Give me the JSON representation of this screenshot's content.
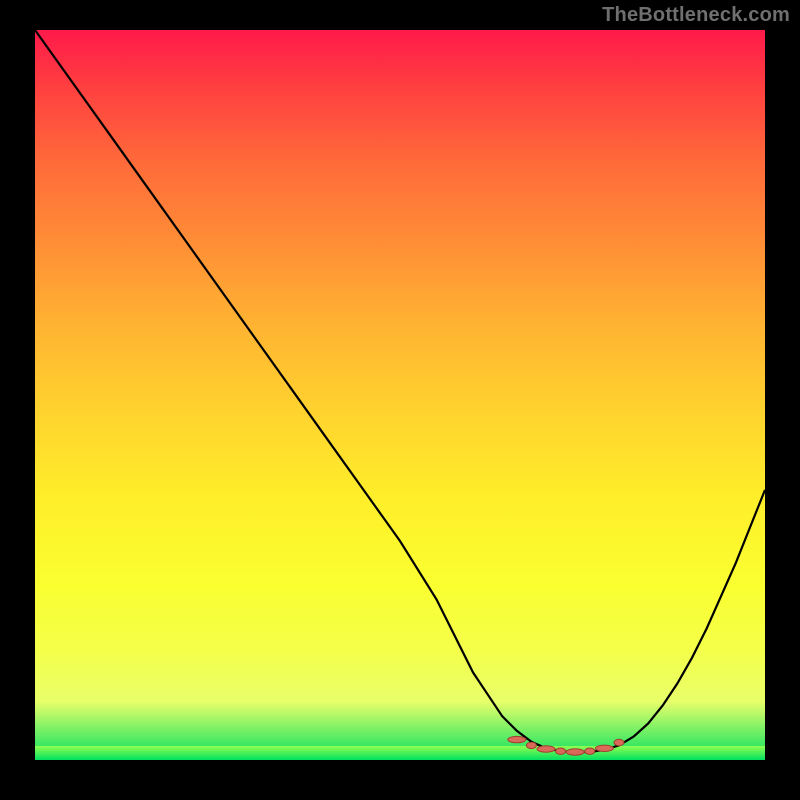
{
  "watermark": "TheBottleneck.com",
  "colors": {
    "background": "#000000",
    "gradient_top": "#ff1a4a",
    "gradient_bottom": "#00e060",
    "curve": "#000000",
    "marker": "#d96a5a"
  },
  "chart_data": {
    "type": "line",
    "title": "",
    "xlabel": "",
    "ylabel": "",
    "xlim": [
      0,
      100
    ],
    "ylim": [
      0,
      100
    ],
    "grid": false,
    "legend": false,
    "x": [
      0,
      5,
      10,
      15,
      20,
      25,
      30,
      35,
      40,
      45,
      50,
      55,
      58,
      60,
      62,
      64,
      66,
      68,
      70,
      72,
      74,
      76,
      78,
      80,
      82,
      84,
      86,
      88,
      90,
      92,
      94,
      96,
      98,
      100
    ],
    "values": [
      100,
      93,
      86,
      79,
      72,
      65,
      58,
      51,
      44,
      37,
      30,
      22,
      16,
      12,
      9,
      6,
      4,
      2.5,
      1.6,
      1.2,
      1.1,
      1.1,
      1.4,
      2,
      3.2,
      5,
      7.5,
      10.5,
      14,
      18,
      22.5,
      27,
      32,
      37
    ],
    "markers": {
      "x": [
        66,
        68,
        70,
        72,
        74,
        76,
        78,
        80
      ],
      "y": [
        2.8,
        2.0,
        1.5,
        1.2,
        1.1,
        1.2,
        1.6,
        2.4
      ]
    },
    "note": "x and y are in percent of the plot area; axes are unlabeled in the source image so values are estimated from pixel positions."
  }
}
